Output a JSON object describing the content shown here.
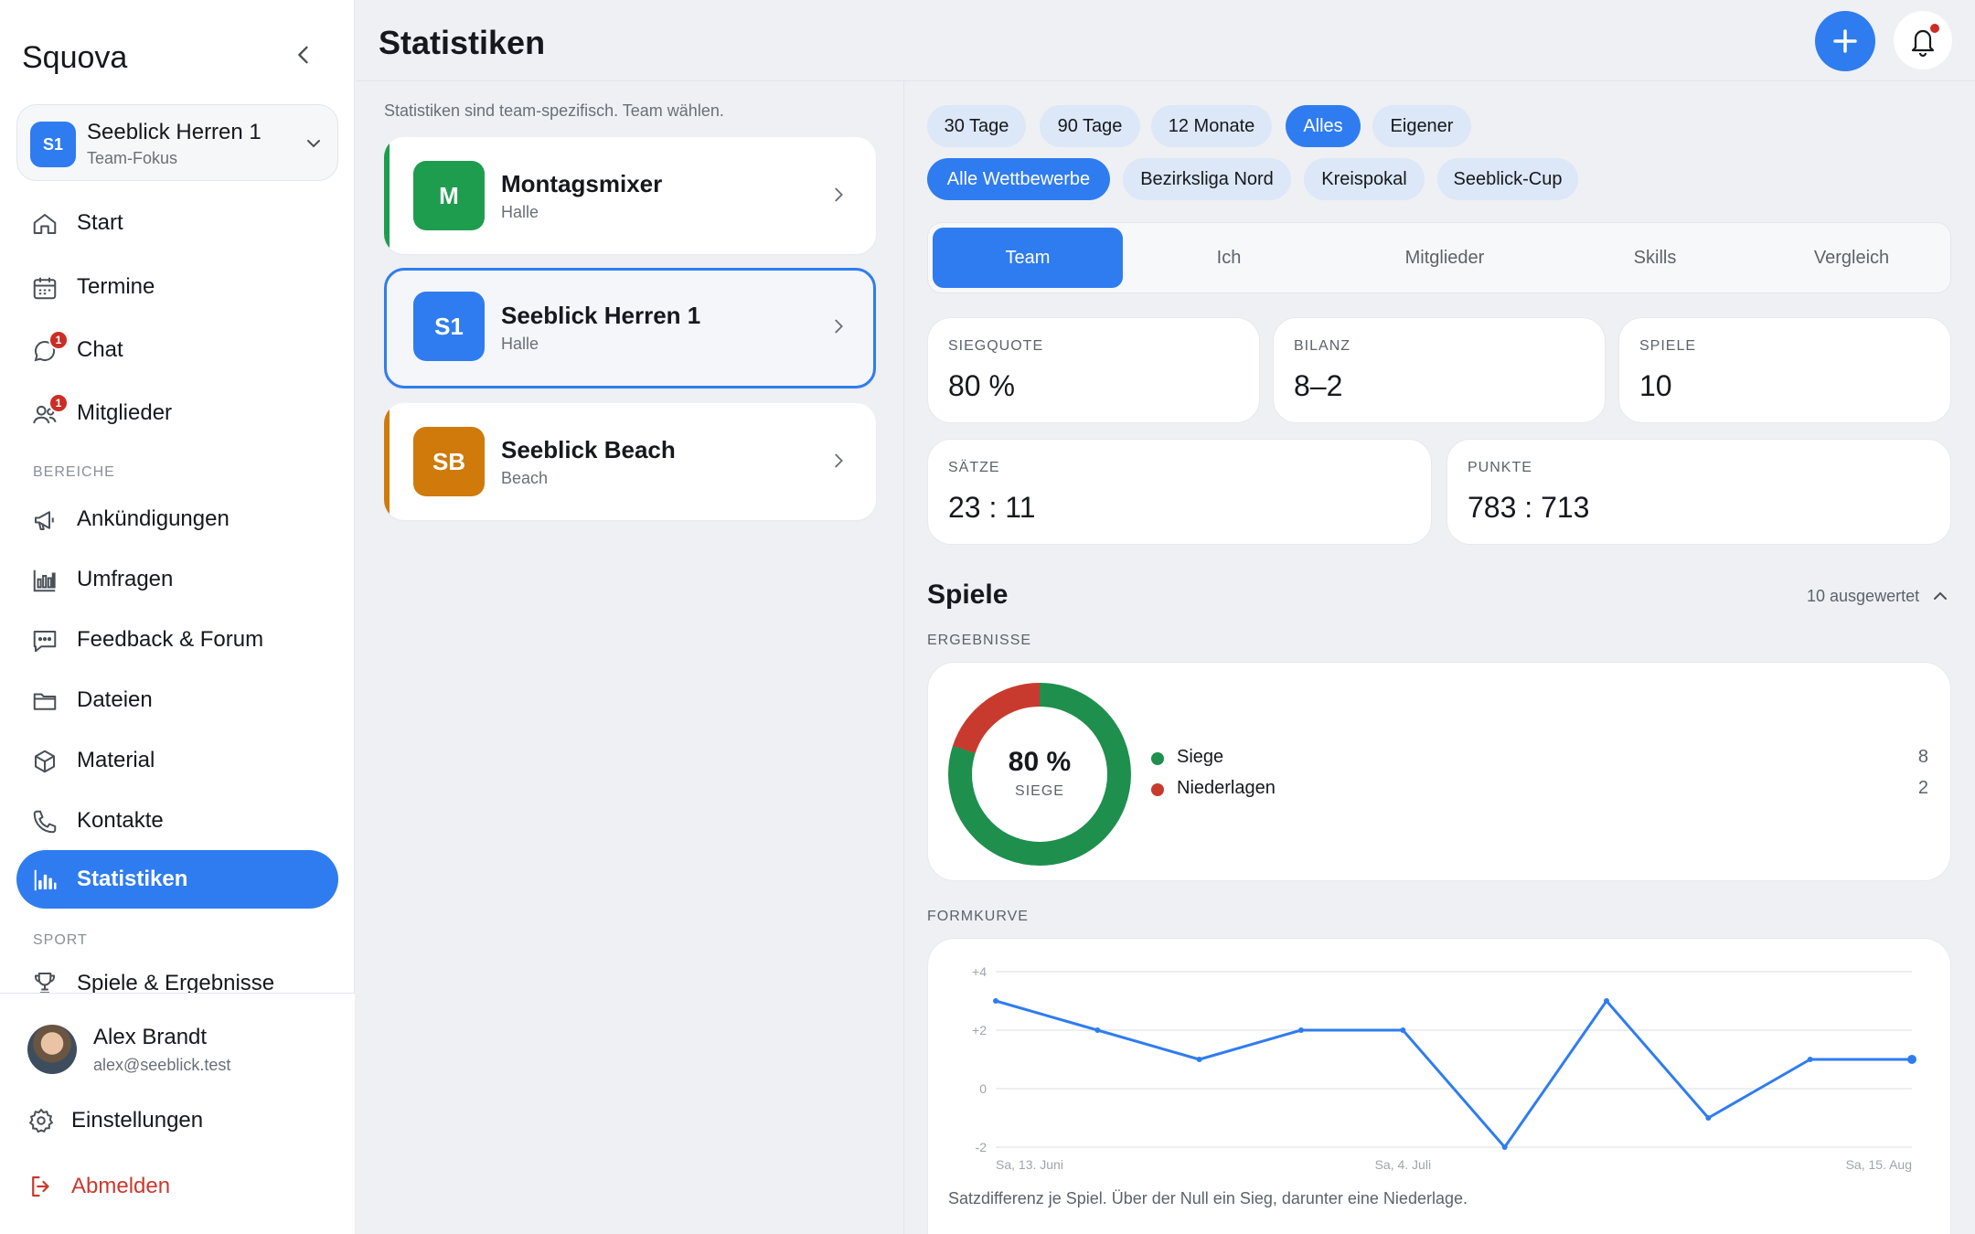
{
  "app": {
    "name": "Squova"
  },
  "team_switcher": {
    "badge": "S1",
    "name": "Seeblick Herren 1",
    "subtitle": "Team-Fokus"
  },
  "nav": {
    "main": [
      {
        "id": "start",
        "label": "Start",
        "icon": "home-icon"
      },
      {
        "id": "termine",
        "label": "Termine",
        "icon": "calendar-icon"
      },
      {
        "id": "chat",
        "label": "Chat",
        "icon": "chat-bubble-icon",
        "badge": "1"
      },
      {
        "id": "mitglieder",
        "label": "Mitglieder",
        "icon": "people-icon",
        "badge": "1"
      }
    ],
    "section_bereiche": "BEREICHE",
    "bereiche": [
      {
        "id": "ankuendigungen",
        "label": "Ankündigungen",
        "icon": "megaphone-icon"
      },
      {
        "id": "umfragen",
        "label": "Umfragen",
        "icon": "bar-chart-icon"
      },
      {
        "id": "feedback",
        "label": "Feedback & Forum",
        "icon": "message-icon"
      },
      {
        "id": "dateien",
        "label": "Dateien",
        "icon": "folder-icon"
      },
      {
        "id": "material",
        "label": "Material",
        "icon": "box-icon"
      },
      {
        "id": "kontakte",
        "label": "Kontakte",
        "icon": "phone-icon"
      },
      {
        "id": "statistiken",
        "label": "Statistiken",
        "icon": "stats-icon",
        "active": true
      }
    ],
    "section_sport": "SPORT",
    "sport": [
      {
        "id": "spiele",
        "label": "Spiele & Ergebnisse",
        "icon": "trophy-icon"
      }
    ]
  },
  "user": {
    "name": "Alex Brandt",
    "email": "alex@seeblick.test"
  },
  "footer": {
    "settings": "Einstellungen",
    "logout": "Abmelden"
  },
  "header": {
    "title": "Statistiken"
  },
  "teams": {
    "hint": "Statistiken sind team-spezifisch. Team wählen.",
    "items": [
      {
        "badge": "M",
        "name": "Montagsmixer",
        "type": "Halle",
        "color": "#1f9d4f"
      },
      {
        "badge": "S1",
        "name": "Seeblick Herren 1",
        "type": "Halle",
        "color": "#2f7cf0",
        "selected": true
      },
      {
        "badge": "SB",
        "name": "Seeblick Beach",
        "type": "Beach",
        "color": "#cf7a0a"
      }
    ]
  },
  "filters": {
    "periods": [
      {
        "label": "30 Tage"
      },
      {
        "label": "90 Tage"
      },
      {
        "label": "12 Monate"
      },
      {
        "label": "Alles",
        "active": true
      },
      {
        "label": "Eigener"
      }
    ],
    "competitions": [
      {
        "label": "Alle Wettbewerbe",
        "active": true
      },
      {
        "label": "Bezirksliga Nord"
      },
      {
        "label": "Kreispokal"
      },
      {
        "label": "Seeblick-Cup"
      }
    ]
  },
  "tabs": [
    {
      "label": "Team",
      "active": true
    },
    {
      "label": "Ich"
    },
    {
      "label": "Mitglieder"
    },
    {
      "label": "Skills"
    },
    {
      "label": "Vergleich"
    }
  ],
  "stats": {
    "siegquote": {
      "label": "SIEGQUOTE",
      "value": "80 %"
    },
    "bilanz": {
      "label": "BILANZ",
      "value": "8–2"
    },
    "spiele": {
      "label": "SPIELE",
      "value": "10"
    },
    "saetze": {
      "label": "SÄTZE",
      "value": "23 : 11"
    },
    "punkte": {
      "label": "PUNKTE",
      "value": "783 : 713"
    }
  },
  "spiele_section": {
    "title": "Spiele",
    "meta": "10 ausgewertet",
    "results_caption": "ERGEBNISSE",
    "form_caption": "FORMKURVE"
  },
  "results": {
    "center_value": "80 %",
    "center_label": "SIEGE",
    "legend": [
      {
        "label": "Siege",
        "value": "8",
        "color": "#1f8f4e"
      },
      {
        "label": "Niederlagen",
        "value": "2",
        "color": "#c93a2e"
      }
    ]
  },
  "form_note": "Satzdifferenz je Spiel. Über der Null ein Sieg, darunter eine Niederlage.",
  "chart_data": [
    {
      "type": "pie",
      "labels": [
        "Siege",
        "Niederlagen"
      ],
      "values": [
        8,
        2
      ],
      "colors": [
        "#1f8f4e",
        "#c93a2e"
      ]
    },
    {
      "type": "line",
      "x": [
        "Sa, 13. Juni",
        "",
        "",
        "",
        "Sa, 4. Juli",
        "",
        "",
        "",
        "",
        "Sa, 15. Aug"
      ],
      "x_ticks": [
        "Sa, 13. Juni",
        "Sa, 4. Juli",
        "Sa, 15. Aug"
      ],
      "y_ticks": [
        "+4",
        "+2",
        "0",
        "-2"
      ],
      "ylim": [
        -2,
        4
      ],
      "series": [
        {
          "values": [
            3,
            2,
            1,
            2,
            2,
            -2,
            3,
            -1,
            1,
            1
          ],
          "color": "#2f7cf0"
        }
      ],
      "grid": true
    }
  ]
}
